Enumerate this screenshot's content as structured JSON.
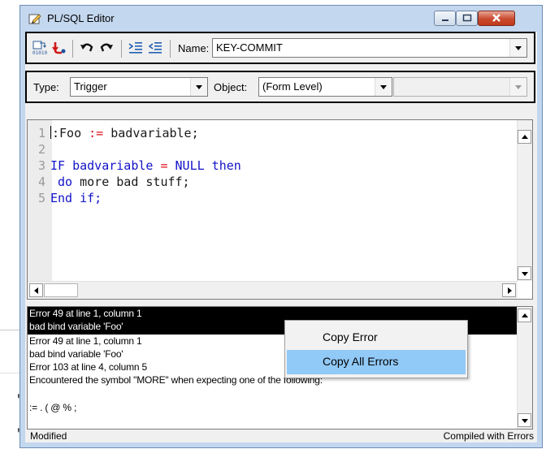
{
  "window": {
    "title": "PL/SQL Editor",
    "icon": "editor-pencil-icon"
  },
  "toolbar": {
    "icons": [
      "compile-icon",
      "revert-icon",
      "undo-icon",
      "redo-icon",
      "indent-icon",
      "outdent-icon"
    ],
    "name_label": "Name:",
    "name_value": "KEY-COMMIT"
  },
  "filter": {
    "type_label": "Type:",
    "type_value": "Trigger",
    "object_label": "Object:",
    "object_value": "(Form Level)",
    "object2_value": ""
  },
  "code": {
    "lines": [
      {
        "n": "1",
        "text": ":Foo := badvariable;"
      },
      {
        "n": "2",
        "text": ""
      },
      {
        "n": "3",
        "text": "IF badvariable = NULL then"
      },
      {
        "n": "4",
        "text": "  do more bad stuff;"
      },
      {
        "n": "5",
        "text": "End if;"
      }
    ]
  },
  "errors": {
    "lines": [
      "Error 49 at line 1, column 1",
      "  bad bind variable 'Foo'",
      "Error 49 at line 1, column 1",
      "  bad bind variable 'Foo'",
      "Error 103 at line 4, column 5",
      "  Encountered the symbol \"MORE\" when expecting one of the following:",
      "",
      "     := . ( @ % ;"
    ]
  },
  "context_menu": {
    "items": [
      "Copy Error",
      "Copy All Errors"
    ],
    "active_index": 1
  },
  "status": {
    "left": "Modified",
    "right": "Compiled with Errors"
  },
  "background": {
    "fragments": [
      "'",
      "'"
    ]
  },
  "colors": {
    "keyword": "#1212c8",
    "operator": "#e0101a",
    "highlight": "#91c9f7",
    "window_frame": "#c3d7ee"
  }
}
